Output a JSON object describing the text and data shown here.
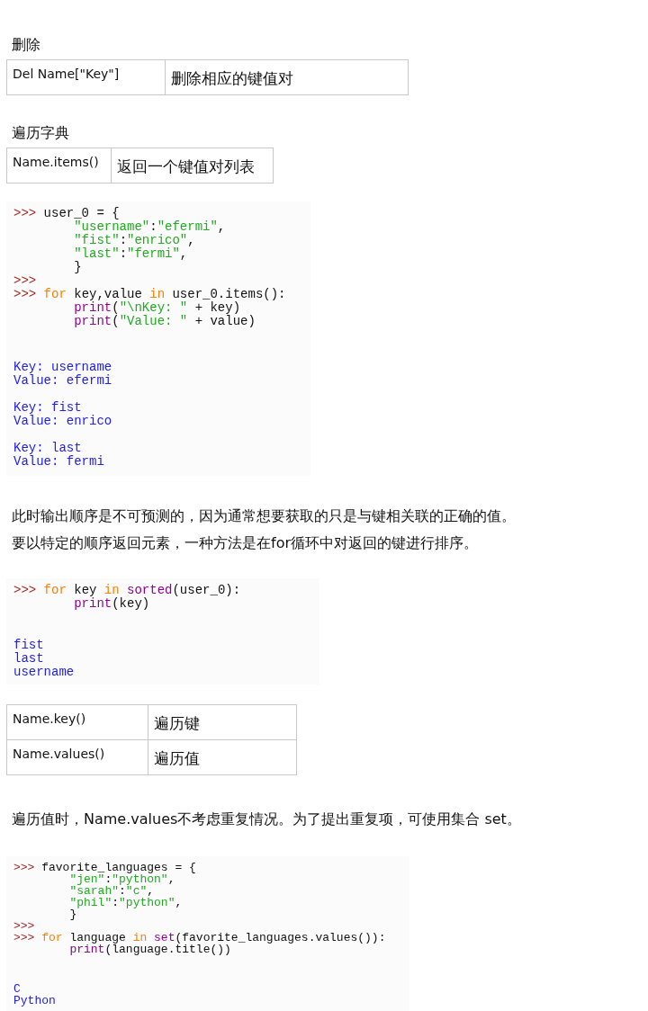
{
  "blocks": [
    {
      "kind": "heading",
      "text": "删除"
    },
    {
      "kind": "table",
      "rows": [
        [
          "Del Name[\"Key\"]",
          "删除相应的键值对"
        ]
      ]
    },
    {
      "kind": "heading",
      "text": "遍历字典"
    },
    {
      "kind": "table",
      "rows": [
        [
          "Name.items()",
          "返回一个键值对列表"
        ]
      ]
    },
    {
      "kind": "code",
      "input": [
        {
          "indent": false,
          "tokens": [
            {
              "kind": "prompt",
              "text": ">>>"
            },
            {
              "kind": "plain",
              "text": "user_0 = {"
            }
          ]
        },
        {
          "indent": true,
          "tokens": [
            {
              "kind": "string",
              "text": "\"username\""
            },
            {
              "kind": "plain",
              "text": ":"
            },
            {
              "kind": "string",
              "text": "\"efermi\""
            },
            {
              "kind": "plain",
              "text": ","
            }
          ]
        },
        {
          "indent": true,
          "tokens": [
            {
              "kind": "string",
              "text": "\"fist\""
            },
            {
              "kind": "plain",
              "text": ":"
            },
            {
              "kind": "string",
              "text": "\"enrico\""
            },
            {
              "kind": "plain",
              "text": ","
            }
          ]
        },
        {
          "indent": true,
          "tokens": [
            {
              "kind": "string",
              "text": "\"last\""
            },
            {
              "kind": "plain",
              "text": ":"
            },
            {
              "kind": "string",
              "text": "\"fermi\""
            },
            {
              "kind": "plain",
              "text": ","
            }
          ]
        },
        {
          "indent": true,
          "tokens": [
            {
              "kind": "plain",
              "text": "}"
            }
          ]
        },
        {
          "indent": false,
          "tokens": [
            {
              "kind": "prompt",
              "text": ">>>"
            }
          ]
        },
        {
          "indent": false,
          "tokens": [
            {
              "kind": "prompt",
              "text": ">>>"
            },
            {
              "kind": "keyword",
              "text": "for"
            },
            {
              "kind": "plain",
              "text": " key,value "
            },
            {
              "kind": "keyword",
              "text": "in"
            },
            {
              "kind": "plain",
              "text": " user_0.items():"
            }
          ]
        },
        {
          "indent": true,
          "tokens": [
            {
              "kind": "builtin",
              "text": "print"
            },
            {
              "kind": "plain",
              "text": "("
            },
            {
              "kind": "string",
              "text": "\"\\nKey: \""
            },
            {
              "kind": "plain",
              "text": " + key)"
            }
          ]
        },
        {
          "indent": true,
          "tokens": [
            {
              "kind": "builtin",
              "text": "print"
            },
            {
              "kind": "plain",
              "text": "("
            },
            {
              "kind": "string",
              "text": "\"Value: \""
            },
            {
              "kind": "plain",
              "text": " + value)"
            }
          ]
        }
      ],
      "output": [
        [
          "Key: username",
          "Value: efermi"
        ],
        [
          "Key: fist",
          "Value: enrico"
        ],
        [
          "Key: last",
          "Value: fermi"
        ]
      ]
    },
    {
      "kind": "paragraph",
      "text": "此时输出顺序是不可预测的，因为通常想要获取的只是与键相关联的正确的值。"
    },
    {
      "kind": "paragraph",
      "text": "要以特定的顺序返回元素，一种方法是在for循环中对返回的键进行排序。"
    },
    {
      "kind": "code",
      "input": [
        {
          "indent": false,
          "tokens": [
            {
              "kind": "prompt",
              "text": ">>>"
            },
            {
              "kind": "keyword",
              "text": "for"
            },
            {
              "kind": "plain",
              "text": " key "
            },
            {
              "kind": "keyword",
              "text": "in"
            },
            {
              "kind": "builtin",
              "text": "sorted"
            },
            {
              "kind": "plain",
              "text": "(user_0):"
            }
          ]
        },
        {
          "indent": true,
          "tokens": [
            {
              "kind": "builtin",
              "text": "print"
            },
            {
              "kind": "plain",
              "text": "(key)"
            }
          ]
        }
      ],
      "output": [
        [
          "fist",
          "last",
          "username"
        ]
      ]
    },
    {
      "kind": "table",
      "rows": [
        [
          "Name.key()",
          "遍历键"
        ],
        [
          "Name.values()",
          "遍历值"
        ]
      ]
    },
    {
      "kind": "paragraph",
      "text": "遍历值时，Name.values不考虑重复情况。为了提出重复项，可使用集合 set。"
    },
    {
      "kind": "code",
      "input": [
        {
          "indent": false,
          "tokens": [
            {
              "kind": "prompt",
              "text": ">>>"
            },
            {
              "kind": "plain",
              "text": "favorite_languages = {"
            }
          ]
        },
        {
          "indent": true,
          "tokens": [
            {
              "kind": "string",
              "text": "\"jen\""
            },
            {
              "kind": "plain",
              "text": ":"
            },
            {
              "kind": "string",
              "text": "\"python\""
            },
            {
              "kind": "plain",
              "text": ","
            }
          ]
        },
        {
          "indent": true,
          "tokens": [
            {
              "kind": "string",
              "text": "\"sarah\""
            },
            {
              "kind": "plain",
              "text": ":"
            },
            {
              "kind": "string",
              "text": "\"c\""
            },
            {
              "kind": "plain",
              "text": ","
            }
          ]
        },
        {
          "indent": true,
          "tokens": [
            {
              "kind": "string",
              "text": "\"phil\""
            },
            {
              "kind": "plain",
              "text": ":"
            },
            {
              "kind": "string",
              "text": "\"python\""
            },
            {
              "kind": "plain",
              "text": ","
            }
          ]
        },
        {
          "indent": true,
          "tokens": [
            {
              "kind": "plain",
              "text": "}"
            }
          ]
        },
        {
          "indent": false,
          "tokens": [
            {
              "kind": "prompt",
              "text": ">>>"
            }
          ]
        },
        {
          "indent": false,
          "tokens": [
            {
              "kind": "prompt",
              "text": ">>>"
            },
            {
              "kind": "keyword",
              "text": "for"
            },
            {
              "kind": "plain",
              "text": " language "
            },
            {
              "kind": "keyword",
              "text": "in"
            },
            {
              "kind": "builtin",
              "text": "set"
            },
            {
              "kind": "plain",
              "text": "(favorite_languages.values()):"
            }
          ]
        },
        {
          "indent": true,
          "tokens": [
            {
              "kind": "builtin",
              "text": "print"
            },
            {
              "kind": "plain",
              "text": "(language.title())"
            }
          ]
        }
      ],
      "output": [
        [
          "C",
          "Python"
        ]
      ]
    }
  ]
}
